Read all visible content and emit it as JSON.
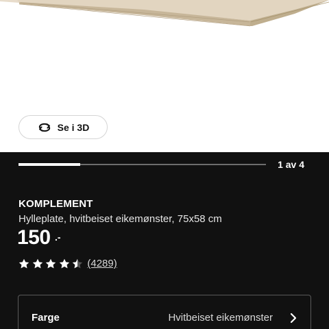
{
  "gallery": {
    "view_3d_label": "Se i 3D",
    "page_counter": "1 av 4",
    "progress_fraction": 0.25
  },
  "product": {
    "name": "KOMPLEMENT",
    "description": "Hylleplate, hvitbeiset eikemønster, 75x58 cm",
    "price": "150",
    "price_suffix": ".-",
    "rating": 4.5,
    "rating_max": 5,
    "review_count": "(4289)"
  },
  "color_option": {
    "label": "Farge",
    "value": "Hvitbeiset eikemønster"
  },
  "icons": {
    "view_3d": "rotate-3d-icon",
    "star": "star-icon",
    "chevron": "chevron-right-icon"
  },
  "colors": {
    "panel_background": "#111111",
    "wood_top": "#e6dac7",
    "wood_edge": "#b9a788"
  }
}
